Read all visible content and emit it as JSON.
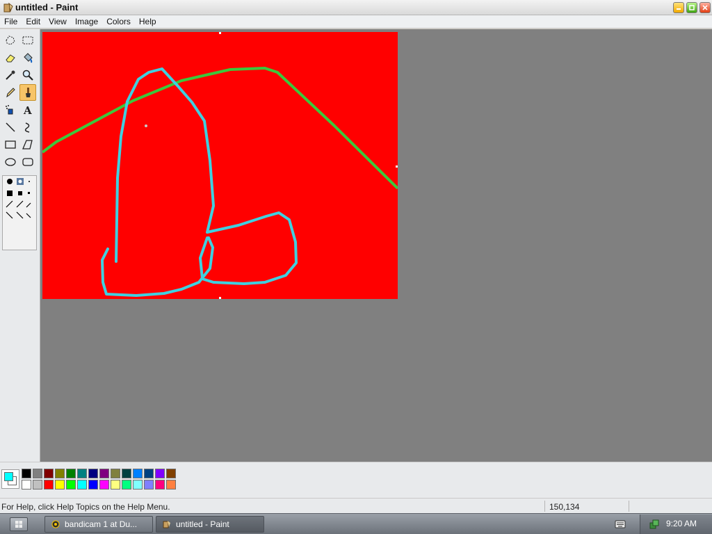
{
  "window": {
    "title": "untitled - Paint"
  },
  "menu": [
    "File",
    "Edit",
    "View",
    "Image",
    "Colors",
    "Help"
  ],
  "toolbox": {
    "tools": [
      "free-form-select",
      "select",
      "eraser",
      "fill-with-color",
      "pick-color",
      "magnifier",
      "pencil",
      "brush",
      "airbrush",
      "text",
      "line",
      "curve",
      "rectangle",
      "polygon",
      "ellipse",
      "rounded-rectangle"
    ],
    "active_tool": "brush"
  },
  "colors": {
    "foreground": "#00ffff",
    "background": "#ffffff",
    "palette_row1": [
      "#000000",
      "#808080",
      "#800000",
      "#808000",
      "#008000",
      "#008080",
      "#000080",
      "#800080",
      "#808040",
      "#004040",
      "#0080ff",
      "#004080",
      "#8000ff",
      "#804000"
    ],
    "palette_row2": [
      "#ffffff",
      "#c0c0c0",
      "#ff0000",
      "#ffff00",
      "#00ff00",
      "#00ffff",
      "#0000ff",
      "#ff00ff",
      "#ffff80",
      "#00ff80",
      "#80ffff",
      "#8080ff",
      "#ff0080",
      "#ff8040"
    ]
  },
  "canvas": {
    "fill": "#ff0000",
    "stroke_cyan": "#3fd0e0",
    "stroke_green": "#3cc83c"
  },
  "status": {
    "help_text": "For Help, click Help Topics on the Help Menu.",
    "coords": "150,134"
  },
  "taskbar": {
    "tasks": [
      "bandicam 1 at Du...",
      "untitled - Paint"
    ],
    "clock": "9:20 AM"
  }
}
